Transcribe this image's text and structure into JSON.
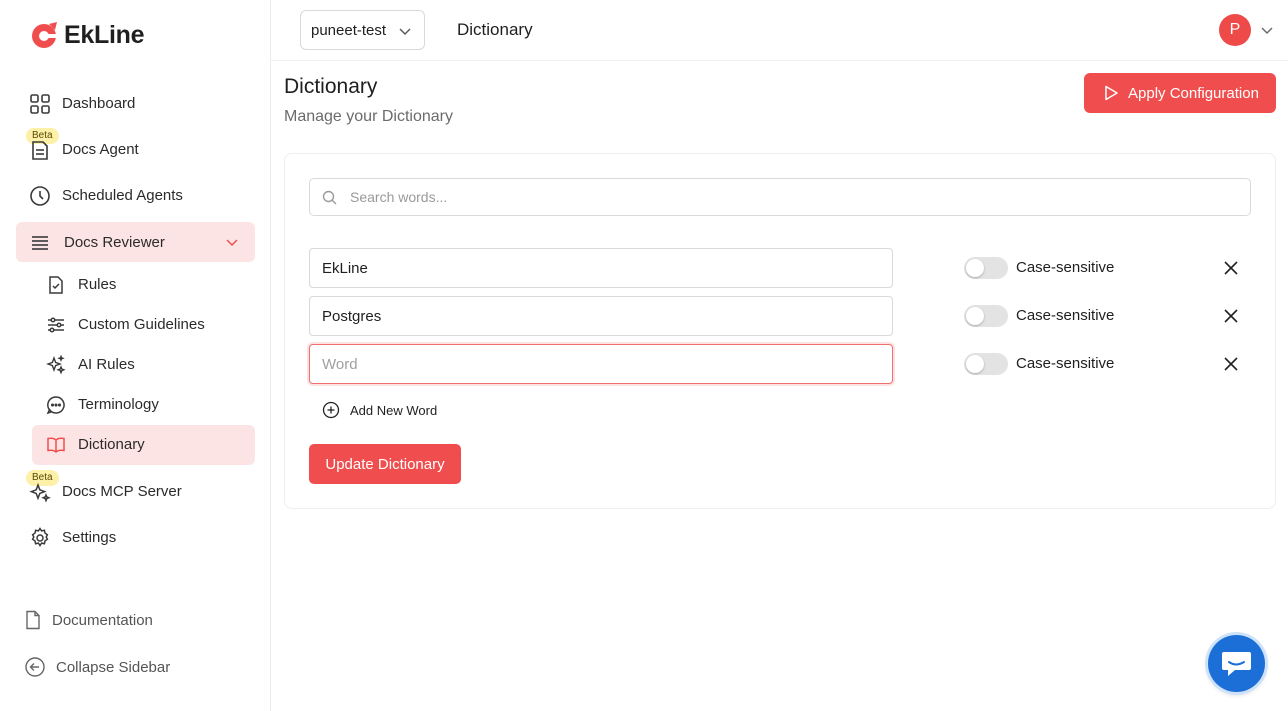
{
  "brand": {
    "name": "EkLine",
    "accent": "#f04e4e"
  },
  "sidebar": {
    "items": [
      {
        "label": "Dashboard",
        "icon": "grid-icon"
      },
      {
        "label": "Docs Agent",
        "icon": "document-icon",
        "badge": "Beta"
      },
      {
        "label": "Scheduled Agents",
        "icon": "clock-icon"
      },
      {
        "label": "Docs Reviewer",
        "icon": "list-icon",
        "expanded": true
      },
      {
        "label": "Docs MCP Server",
        "icon": "sparkle-icon",
        "badge": "Beta"
      },
      {
        "label": "Settings",
        "icon": "gear-icon"
      }
    ],
    "subitems": [
      {
        "label": "Rules",
        "icon": "file-check-icon"
      },
      {
        "label": "Custom Guidelines",
        "icon": "sliders-icon"
      },
      {
        "label": "AI Rules",
        "icon": "sparkle-icon"
      },
      {
        "label": "Terminology",
        "icon": "chat-bubble-icon"
      },
      {
        "label": "Dictionary",
        "icon": "book-icon",
        "active": true
      }
    ],
    "footer": {
      "documentation": "Documentation",
      "collapse": "Collapse Sidebar"
    }
  },
  "header": {
    "org": "puneet-test",
    "title": "Dictionary",
    "avatar_initial": "P"
  },
  "main": {
    "title": "Dictionary",
    "subtitle": "Manage your Dictionary",
    "apply_label": "Apply Configuration",
    "search_placeholder": "Search words...",
    "words": [
      {
        "value": "EkLine",
        "placeholder": "Word",
        "case_label": "Case-sensitive",
        "case_sensitive": false
      },
      {
        "value": "Postgres",
        "placeholder": "Word",
        "case_label": "Case-sensitive",
        "case_sensitive": false
      },
      {
        "value": "",
        "placeholder": "Word",
        "case_label": "Case-sensitive",
        "case_sensitive": false
      }
    ],
    "add_word_label": "Add New Word",
    "update_label": "Update Dictionary"
  }
}
